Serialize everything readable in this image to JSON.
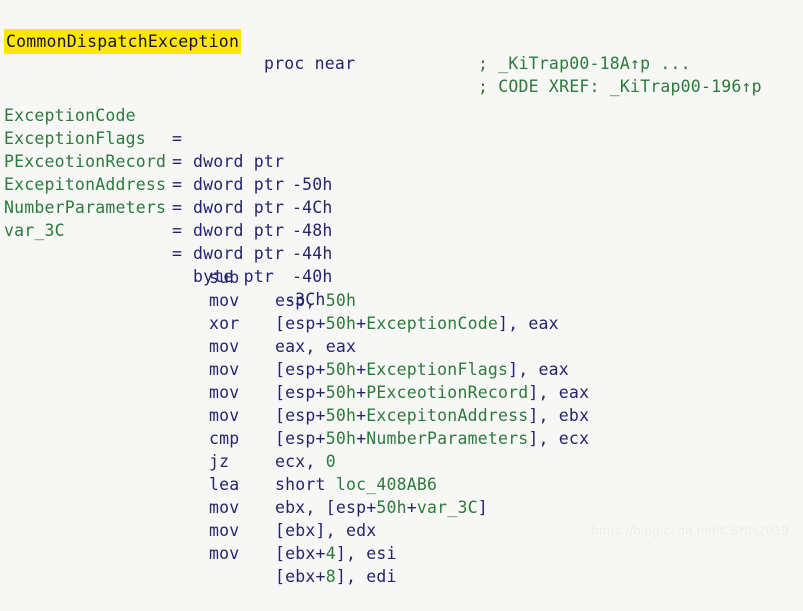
{
  "view": {
    "background": "#f7f7f5",
    "symbol_color": "#2d7a3e",
    "keyword_color": "#25256e",
    "highlight_bg": "#ffe800",
    "highlight_fg": "#14144a"
  },
  "header": {
    "function_name": "CommonDispatchException",
    "proc_keyword": "proc near",
    "comments": [
      "; CODE XREF: _KiTrap00-196↑p",
      "; _KiTrap00-18A↑p ..."
    ]
  },
  "declarations": [
    {
      "name": "ExceptionCode",
      "eq": "=",
      "type": "dword ptr",
      "offset": "-50h"
    },
    {
      "name": "ExceptionFlags",
      "eq": "=",
      "type": "dword ptr",
      "offset": "-4Ch"
    },
    {
      "name": "PExceotionRecord",
      "eq": "=",
      "type": "dword ptr",
      "offset": "-48h"
    },
    {
      "name": "ExcepitonAddress",
      "eq": "=",
      "type": "dword ptr",
      "offset": "-44h"
    },
    {
      "name": "NumberParameters",
      "eq": "=",
      "type": "dword ptr",
      "offset": "-40h"
    },
    {
      "name": "var_3C",
      "eq": "=",
      "type": "byte ptr",
      "offset": "-3Ch"
    }
  ],
  "instructions": [
    {
      "mnemonic": "sub",
      "operands": "esp, 50h"
    },
    {
      "mnemonic": "mov",
      "operands": "[esp+50h+ExceptionCode], eax"
    },
    {
      "mnemonic": "xor",
      "operands": "eax, eax"
    },
    {
      "mnemonic": "mov",
      "operands": "[esp+50h+ExceptionFlags], eax"
    },
    {
      "mnemonic": "mov",
      "operands": "[esp+50h+PExceotionRecord], eax"
    },
    {
      "mnemonic": "mov",
      "operands": "[esp+50h+ExcepitonAddress], ebx"
    },
    {
      "mnemonic": "mov",
      "operands": "[esp+50h+NumberParameters], ecx"
    },
    {
      "mnemonic": "cmp",
      "operands": "ecx, 0"
    },
    {
      "mnemonic": "jz",
      "operands": "short loc_408AB6"
    },
    {
      "mnemonic": "lea",
      "operands": "ebx, [esp+50h+var_3C]"
    },
    {
      "mnemonic": "mov",
      "operands": "[ebx], edx"
    },
    {
      "mnemonic": "mov",
      "operands": "[ebx+4], esi"
    },
    {
      "mnemonic": "mov",
      "operands": "[ebx+8], edi"
    }
  ],
  "watermark": "https://blog.csdn.net/CSNN2019"
}
